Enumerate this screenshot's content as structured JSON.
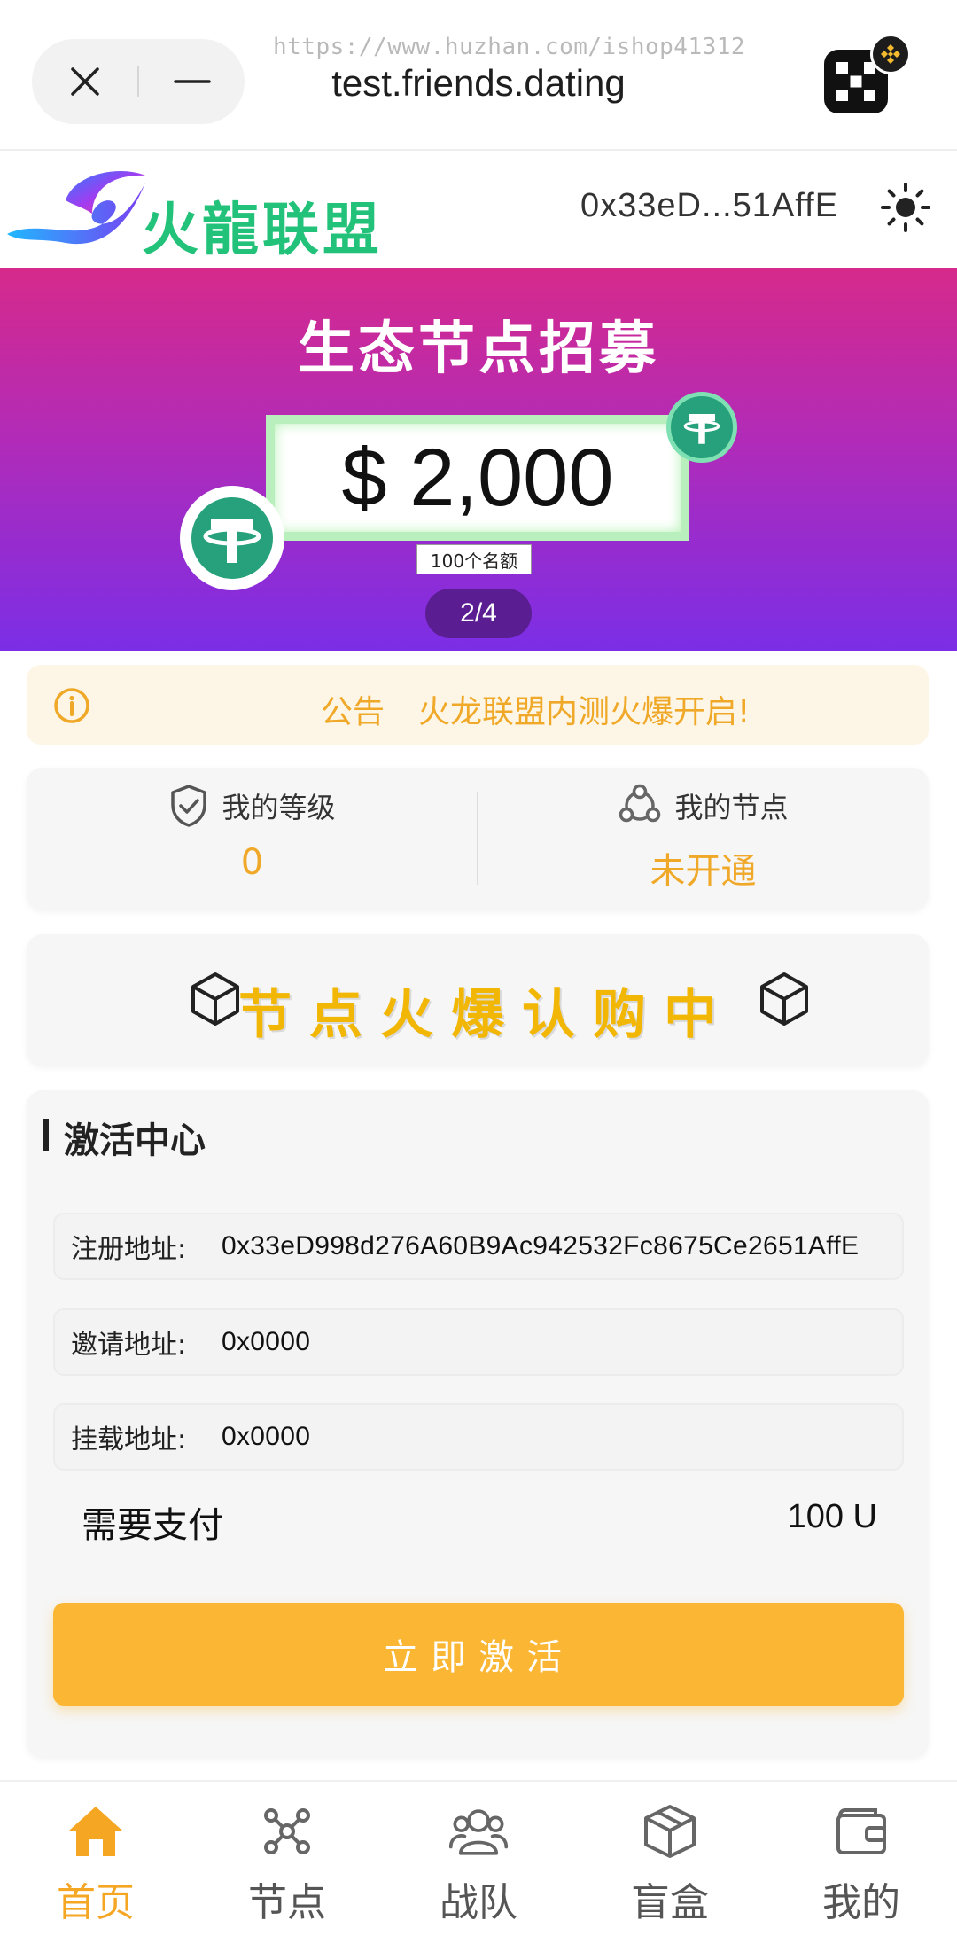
{
  "browser": {
    "url": "test.friends.dating",
    "watermark": "https://www.huzhan.com/ishop41312"
  },
  "header": {
    "logo_text": "火龍联盟",
    "wallet_address": "0x33eD...51AffE"
  },
  "banner": {
    "title": "生态节点招募",
    "amount": "$ 2,000",
    "quota": "100个名额",
    "page_indicator": "2/4"
  },
  "notice": {
    "label": "公告",
    "text": "火龙联盟内测火爆开启!"
  },
  "stats": {
    "level_label": "我的等级",
    "level_value": "0",
    "node_label": "我的节点",
    "node_value": "未开通"
  },
  "promo": {
    "text": "节点火爆认购中"
  },
  "activation": {
    "title": "激活中心",
    "fields": [
      {
        "label": "注册地址:",
        "value": "0x33eD998d276A60B9Ac942532Fc8675Ce2651AffE"
      },
      {
        "label": "邀请地址:",
        "value": "0x0000"
      },
      {
        "label": "挂载地址:",
        "value": "0x0000"
      }
    ],
    "pay_label": "需要支付",
    "pay_value": "100 U",
    "button_label": "立即激活"
  },
  "nav": {
    "items": [
      {
        "label": "首页",
        "icon": "home-icon",
        "active": true
      },
      {
        "label": "节点",
        "icon": "node-network-icon",
        "active": false
      },
      {
        "label": "战队",
        "icon": "team-icon",
        "active": false
      },
      {
        "label": "盲盒",
        "icon": "blind-box-icon",
        "active": false
      },
      {
        "label": "我的",
        "icon": "wallet-icon",
        "active": false
      }
    ]
  },
  "colors": {
    "accent": "#f5a623",
    "button": "#fbb733",
    "banner_top": "#d62a8b",
    "banner_bottom": "#7b2ee6",
    "logo_green": "#23c27a",
    "tether_green": "#26a17b"
  }
}
